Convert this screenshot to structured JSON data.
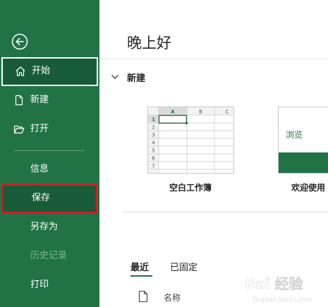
{
  "sidebar": {
    "items": [
      {
        "label": "开始",
        "icon": "home-icon"
      },
      {
        "label": "新建",
        "icon": "new-file-icon"
      },
      {
        "label": "打开",
        "icon": "folder-open-icon"
      },
      {
        "label": "信息"
      },
      {
        "label": "保存"
      },
      {
        "label": "另存为"
      },
      {
        "label": "历史记录"
      },
      {
        "label": "打印"
      }
    ]
  },
  "main": {
    "greeting": "晚上好",
    "new_section": "新建",
    "templates": [
      {
        "label": "空白工作簿"
      },
      {
        "label": "欢迎使用",
        "preview_text": "浏览"
      }
    ],
    "blank_preview": {
      "columns": [
        "A",
        "B",
        "C"
      ],
      "rows": [
        "1",
        "2",
        "3",
        "4",
        "5",
        "6",
        "7"
      ]
    },
    "tabs": [
      "最近",
      "已固定"
    ],
    "list_header": {
      "name_col": "名称"
    }
  },
  "colors": {
    "brand": "#217346",
    "active": "#185c37",
    "highlight_border": "#e81123"
  },
  "watermark": {
    "text": "Bai 经验",
    "sub": "jingyan.baidu.com"
  }
}
